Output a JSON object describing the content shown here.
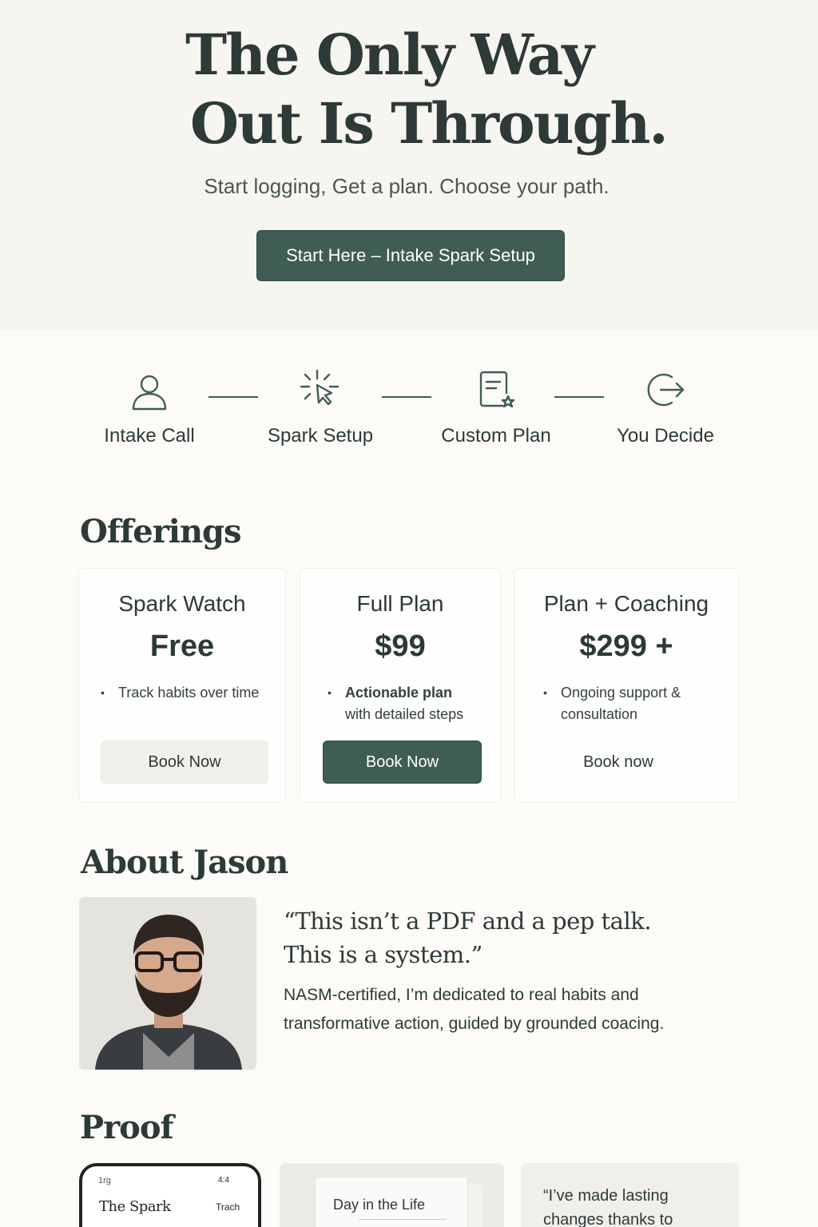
{
  "hero": {
    "title_line1": "The Only Way",
    "title_line2": "Out Is Through.",
    "subtitle": "Start logging, Get a plan. Choose your path.",
    "cta_label": "Start Here – Intake Spark Setup"
  },
  "steps": [
    {
      "label": "Intake Call",
      "icon": "user-icon"
    },
    {
      "label": "Spark Setup",
      "icon": "cursor-click-icon"
    },
    {
      "label": "Custom Plan",
      "icon": "document-star-icon"
    },
    {
      "label": "You Decide",
      "icon": "exit-arrow-icon"
    }
  ],
  "offerings": {
    "title": "Offerings",
    "cards": [
      {
        "name": "Spark Watch",
        "price": "Free",
        "bullet_line1": "Track habits over time",
        "bullet_line2": "",
        "button": "Book Now"
      },
      {
        "name": "Full Plan",
        "price": "$99",
        "bullet_line1": "Actionable plan",
        "bullet_line2": "with detailed steps",
        "button": "Book Now"
      },
      {
        "name": "Plan + Coaching",
        "price": "$299 +",
        "bullet_line1": "Ongoing support &",
        "bullet_line2": "consultation",
        "button": "Book now"
      }
    ]
  },
  "about": {
    "title": "About Jason",
    "quote_line1": "“This isn’t a PDF and a pep talk.",
    "quote_line2": "This is a system.”",
    "text_line1": "NASM-certified, I’m dedicated to real habits and",
    "text_line2": "transformative action, guided by grounded coacing."
  },
  "proof": {
    "title": "Proof",
    "phone_status": "1rg",
    "phone_battery": "4:4",
    "phone_app_title": "The Spark",
    "phone_app_action": "Trach",
    "day_card_title": "Day in the Life",
    "testimonial_line1": "“I’ve made lasting",
    "testimonial_line2": "changes thanks to"
  },
  "colors": {
    "accent": "#3f5d55",
    "background": "#fcfbf7",
    "hero_background": "#f7f5f0",
    "text": "#2d3a37"
  }
}
